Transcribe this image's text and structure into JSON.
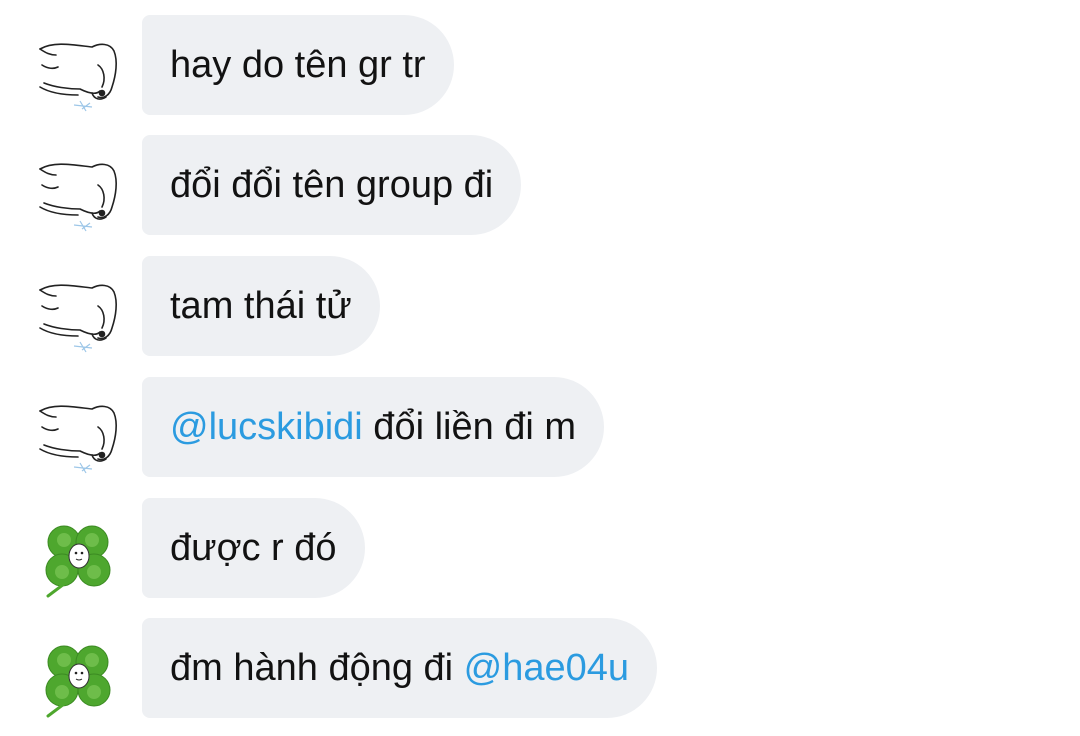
{
  "messages": [
    {
      "avatar": "elephant-sketch-icon",
      "parts": [
        {
          "text": "hay do tên gr tr",
          "mention": false
        }
      ]
    },
    {
      "avatar": "elephant-sketch-icon",
      "parts": [
        {
          "text": "đổi đổi tên group đi",
          "mention": false
        }
      ]
    },
    {
      "avatar": "elephant-sketch-icon",
      "parts": [
        {
          "text": "tam thái tử",
          "mention": false
        }
      ]
    },
    {
      "avatar": "elephant-sketch-icon",
      "parts": [
        {
          "text": "@lucskibidi",
          "mention": true
        },
        {
          "text": " đổi liền đi m",
          "mention": false
        }
      ]
    },
    {
      "avatar": "clover-icon",
      "parts": [
        {
          "text": "được r đó",
          "mention": false
        }
      ]
    },
    {
      "avatar": "clover-icon",
      "parts": [
        {
          "text": "đm hành động đi ",
          "mention": false
        },
        {
          "text": "@hae04u",
          "mention": true
        }
      ]
    }
  ],
  "colors": {
    "bubble_bg": "#eef0f3",
    "text": "#121212",
    "mention": "#2b9be0"
  }
}
